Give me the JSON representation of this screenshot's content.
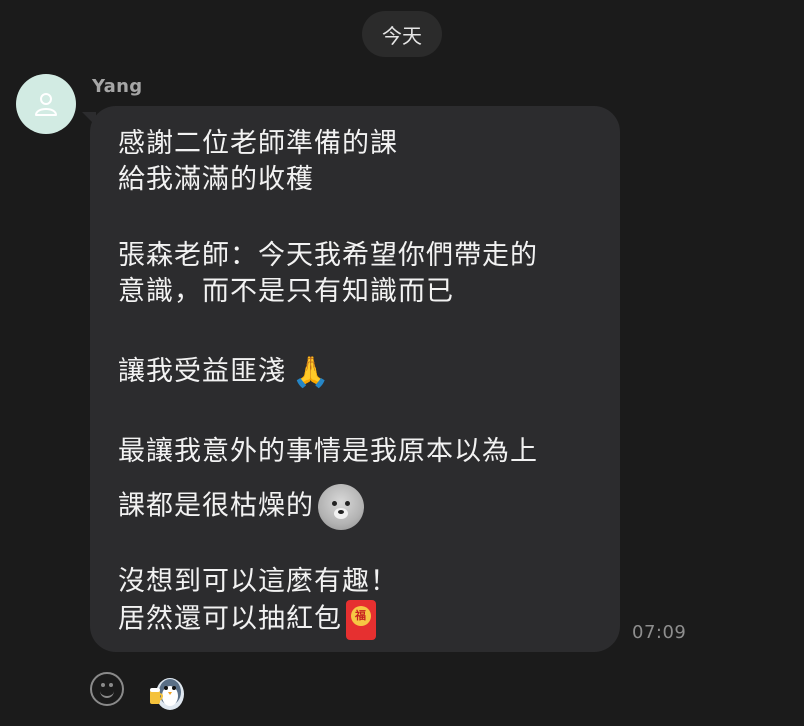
{
  "date_label": "今天",
  "message": {
    "sender": "Yang",
    "time": "07:09",
    "lines": [
      "感謝二位老師準備的課",
      "給我滿滿的收穫",
      "張森老師：今天我希望你們帶走的",
      "意識，而不是只有知識而已",
      "讓我受益匪淺",
      "最讓我意外的事情是我原本以為上",
      "課都是很枯燥的",
      "沒想到可以這麼有趣！",
      "居然還可以抽紅包"
    ],
    "inline_emoji": {
      "pray": "🙏",
      "bear": "bear-face-sticker",
      "red_envelope_seal": "福"
    }
  },
  "icons": {
    "avatar": "person-icon",
    "emoji_picker": "smiley-icon",
    "reaction": "penguin-sticker-icon"
  },
  "colors": {
    "background": "#1b1b1b",
    "bubble": "#2c2c2e",
    "avatar_bg": "#d2ebe3",
    "text": "#f2f2f2",
    "muted": "#8e8e8e"
  }
}
